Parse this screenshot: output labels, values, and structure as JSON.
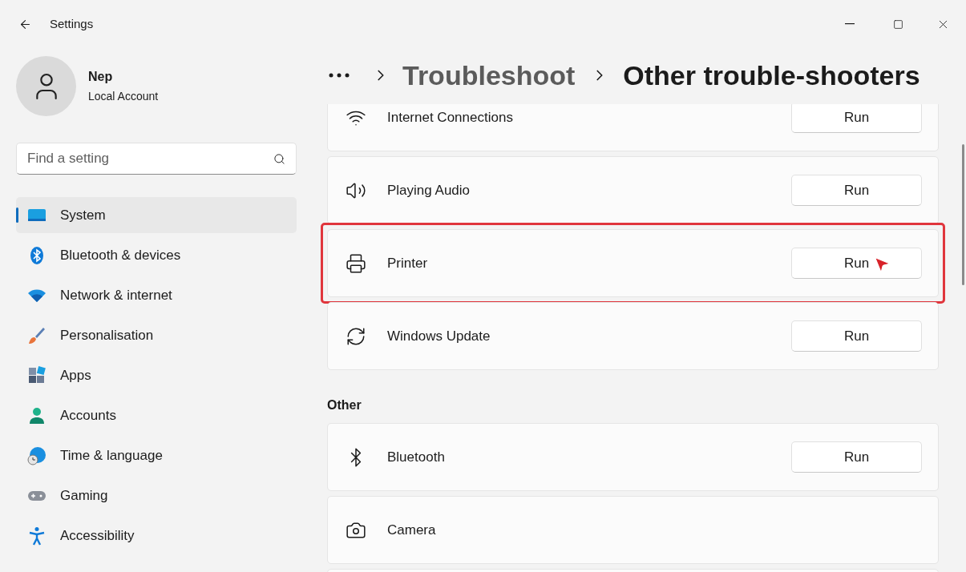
{
  "window": {
    "title": "Settings"
  },
  "user": {
    "name": "Nep",
    "account": "Local Account"
  },
  "search": {
    "placeholder": "Find a setting"
  },
  "nav": [
    {
      "label": "System",
      "selected": true
    },
    {
      "label": "Bluetooth & devices",
      "selected": false
    },
    {
      "label": "Network & internet",
      "selected": false
    },
    {
      "label": "Personalisation",
      "selected": false
    },
    {
      "label": "Apps",
      "selected": false
    },
    {
      "label": "Accounts",
      "selected": false
    },
    {
      "label": "Time & language",
      "selected": false
    },
    {
      "label": "Gaming",
      "selected": false
    },
    {
      "label": "Accessibility",
      "selected": false
    }
  ],
  "breadcrumb": {
    "parent": "Troubleshoot",
    "current": "Other trouble-shooters"
  },
  "sections": [
    {
      "items": [
        {
          "label": "Internet Connections",
          "button": "Run",
          "highlighted": false
        },
        {
          "label": "Playing Audio",
          "button": "Run",
          "highlighted": false
        },
        {
          "label": "Printer",
          "button": "Run",
          "highlighted": true
        },
        {
          "label": "Windows Update",
          "button": "Run",
          "highlighted": false
        }
      ]
    },
    {
      "heading": "Other",
      "items": [
        {
          "label": "Bluetooth",
          "button": "Run",
          "highlighted": false
        },
        {
          "label": "Camera",
          "highlighted": false
        },
        {
          "highlighted": false
        }
      ]
    }
  ]
}
